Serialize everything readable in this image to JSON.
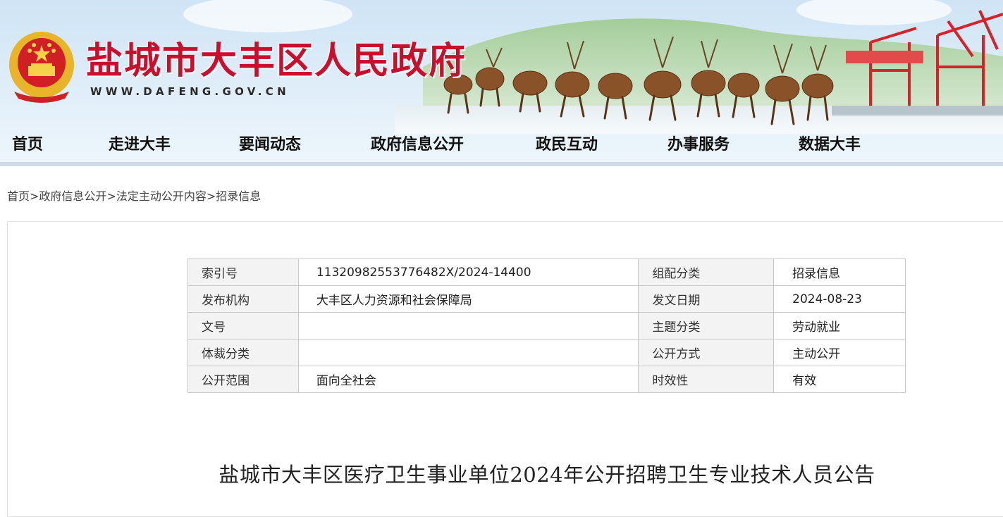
{
  "header": {
    "site_title": "盐城市大丰区人民政府",
    "site_url": "WWW.DAFENG.GOV.CN"
  },
  "nav": {
    "items": [
      "首页",
      "走进大丰",
      "要闻动态",
      "政府信息公开",
      "政民互动",
      "办事服务",
      "数据大丰"
    ]
  },
  "breadcrumb": {
    "items": [
      "首页",
      "政府信息公开",
      "法定主动公开内容",
      "招录信息"
    ],
    "separator": ">"
  },
  "meta": {
    "rows": [
      {
        "label1": "索引号",
        "value1": "11320982553776482X/2024-14400",
        "label2": "组配分类",
        "value2": "招录信息"
      },
      {
        "label1": "发布机构",
        "value1": "大丰区人力资源和社会保障局",
        "label2": "发文日期",
        "value2": "2024-08-23"
      },
      {
        "label1": "文号",
        "value1": "",
        "label2": "主题分类",
        "value2": "劳动就业"
      },
      {
        "label1": "体裁分类",
        "value1": "",
        "label2": "公开方式",
        "value2": "主动公开"
      },
      {
        "label1": "公开范围",
        "value1": "面向全社会",
        "label2": "时效性",
        "value2": "有效"
      }
    ]
  },
  "article": {
    "title": "盐城市大丰区医疗卫生事业单位2024年公开招聘卫生专业技术人员公告"
  },
  "colors": {
    "title_red": "#c8102e",
    "nav_divider": "#cfdbe6",
    "label_bg": "#f3f3f3",
    "table_border": "#c9c9c9"
  },
  "icons": [
    "national-emblem-icon"
  ]
}
